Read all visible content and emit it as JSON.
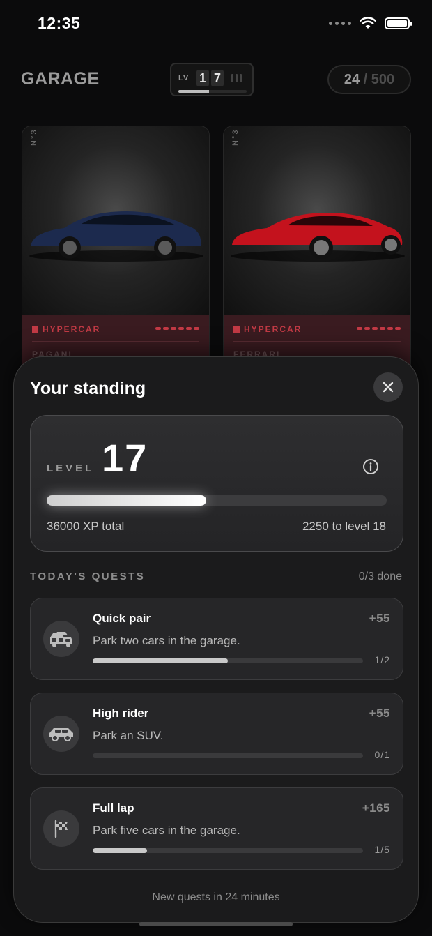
{
  "status_bar": {
    "time": "12:35"
  },
  "header": {
    "title": "GARAGE",
    "level_chip": {
      "prefix": "LV",
      "digit1": "1",
      "digit2": "7",
      "progress": 0.45
    },
    "capacity": {
      "current": "24",
      "separator": "/",
      "max": "500"
    }
  },
  "cars": [
    {
      "number": "N°3",
      "class": "HYPERCAR",
      "make": "PAGANI",
      "color": "#1c2a4e"
    },
    {
      "number": "N°3",
      "class": "HYPERCAR",
      "make": "FERRARI",
      "color": "#c4121d"
    }
  ],
  "sheet": {
    "title": "Your standing",
    "level": {
      "label": "LEVEL",
      "value": "17",
      "progress": 0.47,
      "xp_total": "36000 XP total",
      "xp_next": "2250 to level 18"
    },
    "quests_heading": "TODAY'S QUESTS",
    "quests_done": "0/3 done",
    "quests": [
      {
        "title": "Quick pair",
        "description": "Park two cars in the garage.",
        "reward": "+55",
        "count": "1/2",
        "progress": 0.5,
        "icon": "two-cars-icon"
      },
      {
        "title": "High rider",
        "description": "Park an SUV.",
        "reward": "+55",
        "count": "0/1",
        "progress": 0,
        "icon": "suv-icon"
      },
      {
        "title": "Full lap",
        "description": "Park five cars in the garage.",
        "reward": "+165",
        "count": "1/5",
        "progress": 0.2,
        "icon": "checkered-flag-icon"
      }
    ],
    "refresh_note": "New quests in 24 minutes"
  }
}
